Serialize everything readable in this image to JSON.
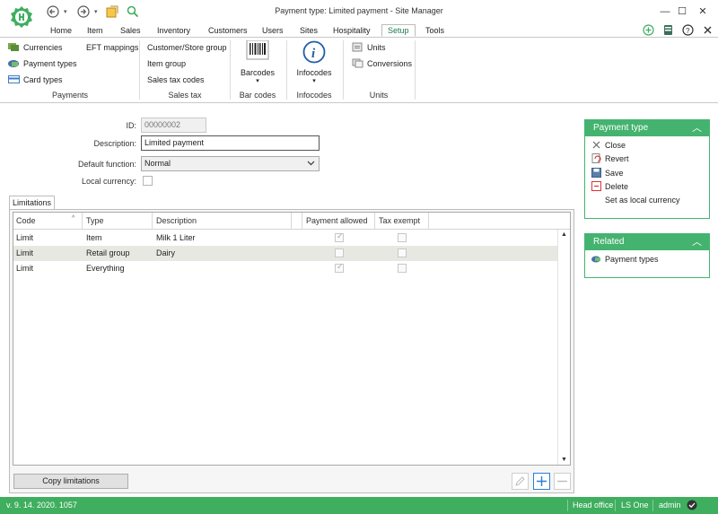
{
  "window": {
    "title": "Payment type:  Limited payment - Site Manager",
    "minimize": "—",
    "maximize": "☐",
    "close": "✕"
  },
  "menu": {
    "tabs": [
      "Home",
      "Item",
      "Sales",
      "Inventory",
      "Customers",
      "Users",
      "Sites",
      "Hospitality",
      "Setup",
      "Tools"
    ],
    "active": "Setup"
  },
  "ribbon": {
    "payments": {
      "items": [
        "Currencies",
        "Payment types",
        "Card types"
      ],
      "eft": "EFT mappings",
      "label": "Payments"
    },
    "sales_tax": {
      "items": [
        "Customer/Store group",
        "Item group",
        "Sales tax codes"
      ],
      "label": "Sales tax"
    },
    "bar_codes": {
      "button": "Barcodes",
      "label": "Bar codes"
    },
    "infocodes": {
      "button": "Infocodes",
      "label": "Infocodes"
    },
    "units": {
      "items": [
        "Units",
        "Conversions"
      ],
      "label": "Units"
    }
  },
  "form": {
    "id_label": "ID:",
    "id_value": "00000002",
    "description_label": "Description:",
    "description_value": "Limited payment",
    "default_function_label": "Default function:",
    "default_function_value": "Normal",
    "local_currency_label": "Local currency:"
  },
  "tabs": {
    "limitations": "Limitations"
  },
  "grid": {
    "columns": [
      "Code",
      "Type",
      "Description",
      "Payment allowed",
      "Tax exempt"
    ],
    "rows": [
      {
        "code": "Limit",
        "type": "Item",
        "description": "Milk 1 Liter",
        "payment_allowed": true,
        "tax_exempt": false
      },
      {
        "code": "Limit",
        "type": "Retail group",
        "description": "Dairy",
        "payment_allowed": false,
        "tax_exempt": false
      },
      {
        "code": "Limit",
        "type": "Everything",
        "description": "",
        "payment_allowed": true,
        "tax_exempt": false
      }
    ],
    "copy_button": "Copy limitations"
  },
  "side_panels": {
    "payment_type": {
      "title": "Payment type",
      "actions": [
        "Close",
        "Revert",
        "Save",
        "Delete",
        "Set as local currency"
      ]
    },
    "related": {
      "title": "Related",
      "items": [
        "Payment types"
      ]
    }
  },
  "status": {
    "version": "v. 9. 14. 2020. 1057",
    "office": "Head office",
    "product": "LS One",
    "user": "admin"
  },
  "colors": {
    "accent": "#44b36f",
    "status_bar": "#3fae5f",
    "active_tab": "#1e7a4a"
  }
}
